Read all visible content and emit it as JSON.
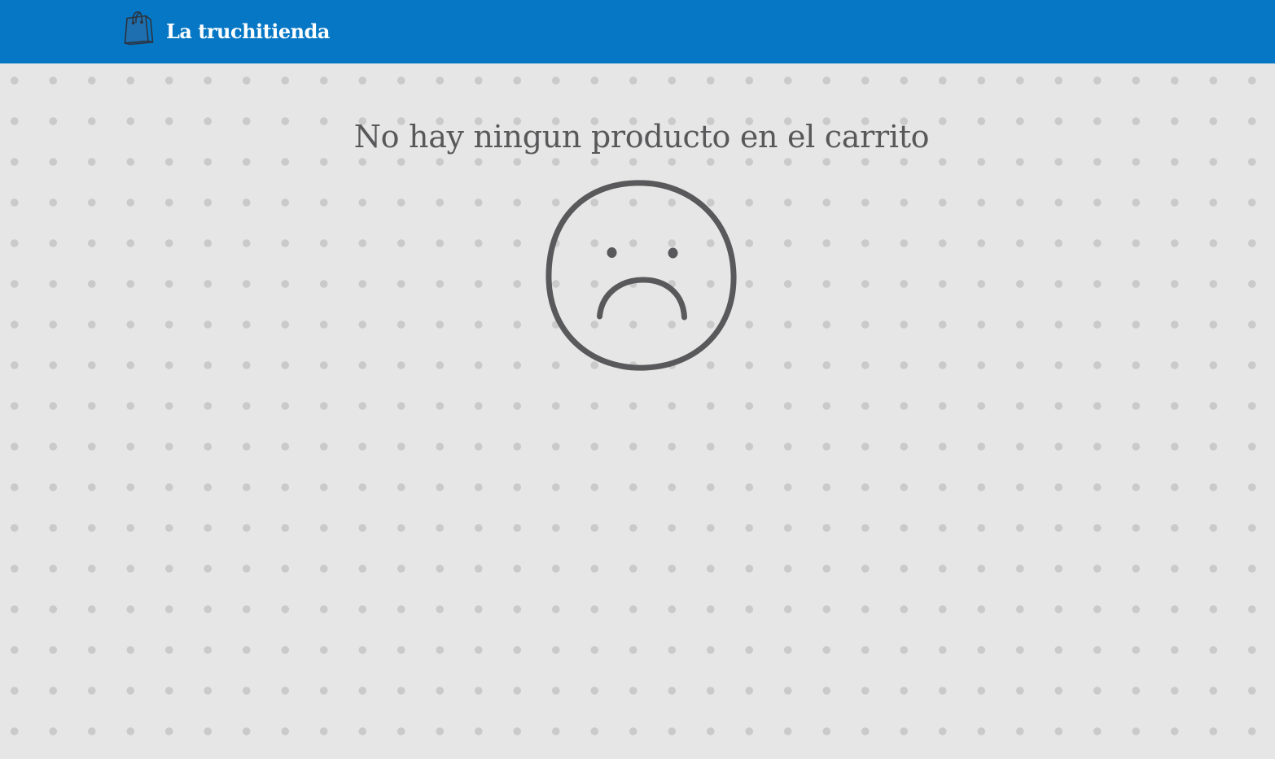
{
  "header": {
    "brand_name": "La truchitienda",
    "brand_icon": "shopping-bag-icon",
    "background_color": "#0677c4"
  },
  "cart": {
    "empty_message": "No hay ningun producto en el carrito",
    "empty_icon": "sad-face-icon",
    "text_color": "#58585a"
  },
  "page": {
    "background_color": "#e6e6e6",
    "pattern": "polka-dots"
  }
}
